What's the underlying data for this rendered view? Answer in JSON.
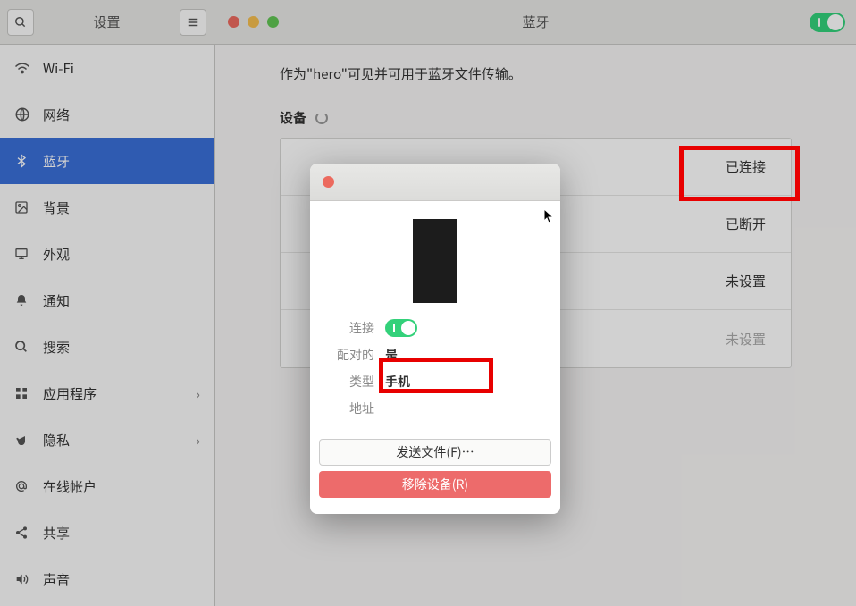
{
  "header": {
    "settings_title": "设置",
    "panel_title": "蓝牙"
  },
  "sidebar": {
    "items": [
      {
        "id": "wifi",
        "label": "Wi-Fi"
      },
      {
        "id": "network",
        "label": "网络"
      },
      {
        "id": "bluetooth",
        "label": "蓝牙"
      },
      {
        "id": "background",
        "label": "背景"
      },
      {
        "id": "appearance",
        "label": "外观"
      },
      {
        "id": "notifications",
        "label": "通知"
      },
      {
        "id": "search",
        "label": "搜索"
      },
      {
        "id": "applications",
        "label": "应用程序"
      },
      {
        "id": "privacy",
        "label": "隐私"
      },
      {
        "id": "online-accounts",
        "label": "在线帐户"
      },
      {
        "id": "sharing",
        "label": "共享"
      },
      {
        "id": "sound",
        "label": "声音"
      }
    ]
  },
  "content": {
    "visibility_text": "作为\"hero\"可见并可用于蓝牙文件传输。",
    "devices_label": "设备",
    "device_statuses": [
      "已连接",
      "已断开",
      "未设置",
      "未设置"
    ]
  },
  "dialog": {
    "props": {
      "connect_label": "连接",
      "paired_label": "配对的",
      "paired_value": "是",
      "type_label": "类型",
      "type_value": "手机",
      "address_label": "地址",
      "address_value": ""
    },
    "send_button": "发送文件(F)…",
    "remove_button": "移除设备(R)"
  }
}
